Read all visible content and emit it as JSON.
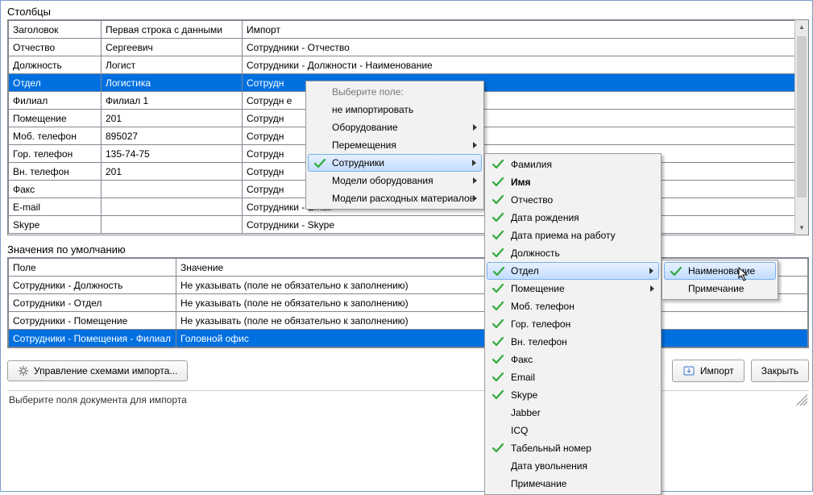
{
  "columns_section": {
    "label": "Столбцы",
    "headers": {
      "title": "Заголовок",
      "first_row": "Первая строка с данными",
      "import": "Импорт"
    },
    "rows": [
      {
        "title": "Отчество",
        "first": "Сергеевич",
        "import": "Сотрудники - Отчество"
      },
      {
        "title": "Должность",
        "first": "Логист",
        "import": "Сотрудники - Должности - Наименование"
      },
      {
        "title": "Отдел",
        "first": "Логистика",
        "import": "Сотрудн",
        "selected": true
      },
      {
        "title": "Филиал",
        "first": "Филиал 1",
        "import": "Сотрудн                                                                  е"
      },
      {
        "title": "Помещение",
        "first": "201",
        "import": "Сотрудн"
      },
      {
        "title": "Моб. телефон",
        "first": "895027",
        "import": "Сотрудн"
      },
      {
        "title": "Гор. телефон",
        "first": "135-74-75",
        "import": "Сотрудн"
      },
      {
        "title": "Вн. телефон",
        "first": "201",
        "import": "Сотрудн"
      },
      {
        "title": "Факс",
        "first": "",
        "import": "Сотрудн"
      },
      {
        "title": "E-mail",
        "first": "",
        "import": "Сотрудники - Email"
      },
      {
        "title": "Skype",
        "first": "",
        "import": "Сотрудники - Skype"
      }
    ]
  },
  "defaults_section": {
    "label": "Значения по умолчанию",
    "headers": {
      "field": "Поле",
      "value": "Значение"
    },
    "rows": [
      {
        "field": "Сотрудники - Должность",
        "value": "Не указывать (поле не обязательно к заполнению)"
      },
      {
        "field": "Сотрудники - Отдел",
        "value": "Не указывать (поле не обязательно к заполнению)"
      },
      {
        "field": "Сотрудники - Помещение",
        "value": "Не указывать (поле не обязательно к заполнению)"
      },
      {
        "field": "Сотрудники - Помещения - Филиал",
        "value": "Головной офис",
        "selected": true
      }
    ]
  },
  "buttons": {
    "schemes": "Управление схемами импорта...",
    "import": "Импорт",
    "close": "Закрыть"
  },
  "status": "Выберите поля документа для импорта",
  "menu1": {
    "header": "Выберите поле:",
    "items": [
      {
        "label": "не импортировать",
        "arrow": false,
        "selected": false
      },
      {
        "label": "Оборудование",
        "arrow": true,
        "selected": false
      },
      {
        "label": "Перемещения",
        "arrow": true,
        "selected": false
      },
      {
        "label": "Сотрудники",
        "arrow": true,
        "selected": true,
        "check": true
      },
      {
        "label": "Модели оборудования",
        "arrow": true,
        "selected": false
      },
      {
        "label": "Модели расходных материалов",
        "arrow": true,
        "selected": false
      }
    ]
  },
  "menu2": {
    "items": [
      {
        "label": "Фамилия",
        "check": true
      },
      {
        "label": "Имя",
        "check": true,
        "bold": true
      },
      {
        "label": "Отчество",
        "check": true
      },
      {
        "label": "Дата рождения",
        "check": true
      },
      {
        "label": "Дата приема на работу",
        "check": true
      },
      {
        "label": "Должность",
        "check": true
      },
      {
        "label": "Отдел",
        "check": true,
        "arrow": true,
        "selected": true
      },
      {
        "label": "Помещение",
        "check": true,
        "arrow": true
      },
      {
        "label": "Моб. телефон",
        "check": true
      },
      {
        "label": "Гор. телефон",
        "check": true
      },
      {
        "label": "Вн. телефон",
        "check": true
      },
      {
        "label": "Факс",
        "check": true
      },
      {
        "label": "Email",
        "check": true
      },
      {
        "label": "Skype",
        "check": true
      },
      {
        "label": "Jabber",
        "check": false
      },
      {
        "label": "ICQ",
        "check": false
      },
      {
        "label": "Табельный номер",
        "check": true
      },
      {
        "label": "Дата увольнения",
        "check": false
      },
      {
        "label": "Примечание",
        "check": false
      }
    ]
  },
  "menu3": {
    "items": [
      {
        "label": "Наименование",
        "check": true,
        "selected": true
      },
      {
        "label": "Примечание",
        "check": false
      }
    ]
  }
}
